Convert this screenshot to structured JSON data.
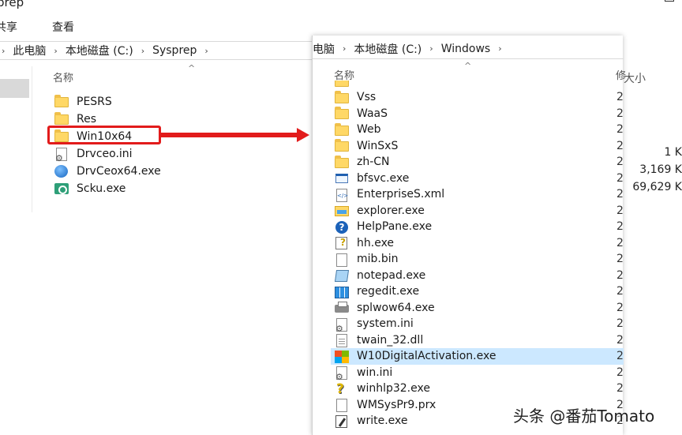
{
  "background_window": {
    "title": "prep",
    "ribbon": {
      "share": "共享",
      "view": "查看"
    },
    "breadcrumb": [
      "此电脑",
      "本地磁盘 (C:)",
      "Sysprep"
    ],
    "column_name": "名称",
    "items": [
      {
        "name": "PESRS",
        "icon": "folder-icon"
      },
      {
        "name": "Res",
        "icon": "folder-icon"
      },
      {
        "name": "Win10x64",
        "icon": "folder-icon"
      },
      {
        "name": "Drvceo.ini",
        "icon": "ini-file-icon"
      },
      {
        "name": "DrvCeox64.exe",
        "icon": "blue-app-icon"
      },
      {
        "name": "Scku.exe",
        "icon": "green-app-icon"
      }
    ],
    "column_size": "大小",
    "sizes": [
      "1 K",
      "3,169 K",
      "69,629 K"
    ]
  },
  "foreground_window": {
    "breadcrumb": [
      "电脑",
      "本地磁盘 (C:)",
      "Windows"
    ],
    "column_name": "名称",
    "column_divider": "修",
    "items": [
      {
        "name": "Vss",
        "icon": "folder-icon",
        "date": "2"
      },
      {
        "name": "WaaS",
        "icon": "folder-icon",
        "date": "2"
      },
      {
        "name": "Web",
        "icon": "folder-icon",
        "date": "2"
      },
      {
        "name": "WinSxS",
        "icon": "folder-icon",
        "date": "2"
      },
      {
        "name": "zh-CN",
        "icon": "folder-icon",
        "date": "2"
      },
      {
        "name": "bfsvc.exe",
        "icon": "app-window-icon",
        "date": "2"
      },
      {
        "name": "EnterpriseS.xml",
        "icon": "xml-file-icon",
        "date": "2"
      },
      {
        "name": "explorer.exe",
        "icon": "explorer-icon",
        "date": "2"
      },
      {
        "name": "HelpPane.exe",
        "icon": "help-icon",
        "date": "2"
      },
      {
        "name": "hh.exe",
        "icon": "help-file-icon",
        "date": "2"
      },
      {
        "name": "mib.bin",
        "icon": "blank-file-icon",
        "date": "2"
      },
      {
        "name": "notepad.exe",
        "icon": "notepad-icon",
        "date": "2"
      },
      {
        "name": "regedit.exe",
        "icon": "regedit-icon",
        "date": "2"
      },
      {
        "name": "splwow64.exe",
        "icon": "printer-icon",
        "date": "2"
      },
      {
        "name": "system.ini",
        "icon": "ini-file-icon",
        "date": "2"
      },
      {
        "name": "twain_32.dll",
        "icon": "dll-file-icon",
        "date": "2"
      },
      {
        "name": "W10DigitalActivation.exe",
        "icon": "windows-logo-icon",
        "date": "2"
      },
      {
        "name": "win.ini",
        "icon": "ini-file-icon",
        "date": "2"
      },
      {
        "name": "winhlp32.exe",
        "icon": "question-mark-icon",
        "date": "2"
      },
      {
        "name": "WMSysPr9.prx",
        "icon": "blank-file-icon",
        "date": "2"
      },
      {
        "name": "write.exe",
        "icon": "write-icon",
        "date": "2"
      }
    ],
    "selected_index": 16
  },
  "highlight_color": "#e21b1b",
  "selection_color": "#cce8ff",
  "watermark": "头条 @番茄Tomato"
}
